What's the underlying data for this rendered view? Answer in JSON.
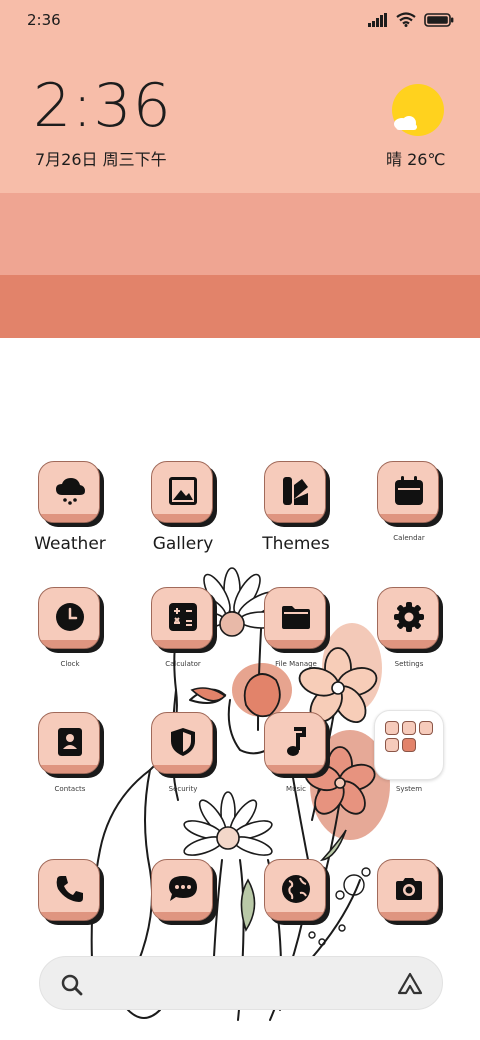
{
  "status_bar": {
    "time": "2:36"
  },
  "widget": {
    "time": "2:36",
    "date": "7月26日 周三下午",
    "weather": "晴 26℃"
  },
  "colors": {
    "band_top": "#f7bda9",
    "band_mid": "#efa592",
    "band_bottom": "#e2836a",
    "tile_face": "#f6cbbb",
    "tile_rim": "#df9580"
  },
  "apps": [
    {
      "label": "Weather",
      "icon": "cloud-snow-icon"
    },
    {
      "label": "Gallery",
      "icon": "image-icon"
    },
    {
      "label": "Themes",
      "icon": "themes-icon"
    },
    {
      "label": "Calendar",
      "icon": "calendar-icon"
    },
    {
      "label": "Clock",
      "icon": "clock-icon"
    },
    {
      "label": "Calculator",
      "icon": "calculator-icon"
    },
    {
      "label": "File Manage",
      "icon": "folder-icon"
    },
    {
      "label": "Settings",
      "icon": "gear-icon"
    },
    {
      "label": "Contacts",
      "icon": "contacts-icon"
    },
    {
      "label": "Security",
      "icon": "shield-icon"
    },
    {
      "label": "Music",
      "icon": "music-note-icon"
    },
    {
      "label": "System",
      "icon": "folder-icon"
    }
  ],
  "dock": [
    {
      "icon": "phone-icon"
    },
    {
      "icon": "message-icon"
    },
    {
      "icon": "globe-icon"
    },
    {
      "icon": "camera-icon"
    }
  ],
  "search": {
    "icon": "search-icon",
    "assistant_icon": "assistant-icon"
  }
}
